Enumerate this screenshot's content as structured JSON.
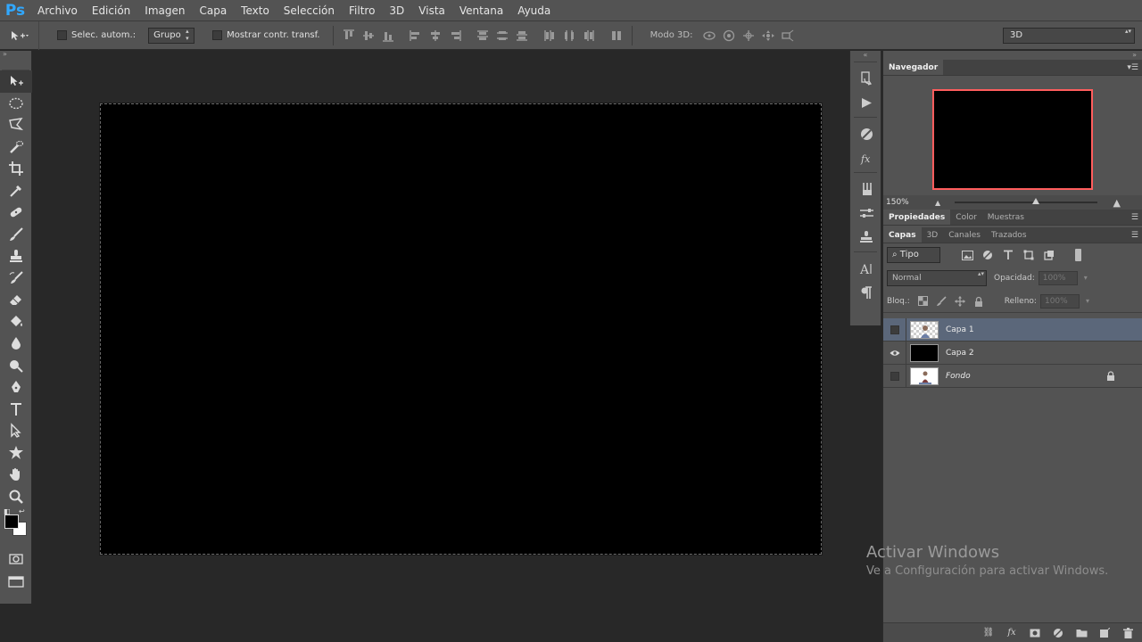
{
  "app": {
    "logo": "Ps"
  },
  "menubar": {
    "items": [
      "Archivo",
      "Edición",
      "Imagen",
      "Capa",
      "Texto",
      "Selección",
      "Filtro",
      "3D",
      "Vista",
      "Ventana",
      "Ayuda"
    ]
  },
  "options": {
    "auto_select_label": "Selec. autom.:",
    "auto_select_value": "Grupo",
    "show_transform_label": "Mostrar contr. transf.",
    "mode3d_label": "Modo 3D:",
    "workspace_value": "3D"
  },
  "navigator": {
    "tab": "Navegador",
    "zoom": "150%",
    "view_color": "#ff5d5d"
  },
  "properties_tabs": [
    "Propiedades",
    "Color",
    "Muestras"
  ],
  "layers_tabs": [
    "Capas",
    "3D",
    "Canales",
    "Trazados"
  ],
  "layers_panel": {
    "filter_value": "Tipo",
    "blend_mode": "Normal",
    "opacity_label": "Opacidad:",
    "opacity_value": "100%",
    "lock_label": "Bloq.:",
    "fill_label": "Relleno:",
    "fill_value": "100%",
    "layers": [
      {
        "name": "Capa 1",
        "selected": true,
        "visible": false
      },
      {
        "name": "Capa 2",
        "selected": false,
        "visible": true
      },
      {
        "name": "Fondo",
        "selected": false,
        "visible": false,
        "locked": true
      }
    ]
  },
  "watermark": {
    "title": "Activar Windows",
    "subtitle": "Ve a Configuración para activar Windows."
  },
  "colors": {
    "foreground": "#000000",
    "background": "#ffffff",
    "selection": "#5b677a"
  }
}
